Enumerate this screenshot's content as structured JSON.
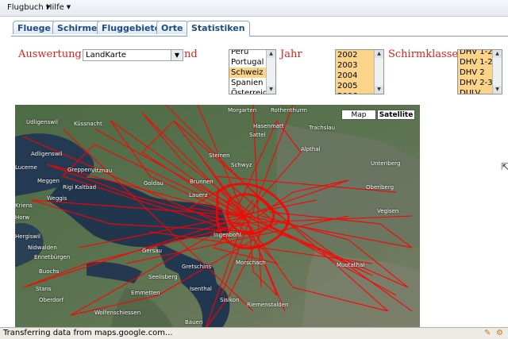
{
  "menubar": {
    "items": [
      {
        "label": "Flugbuch"
      },
      {
        "label": "Hilfe"
      }
    ]
  },
  "tabs": [
    {
      "label": "Fluege"
    },
    {
      "label": "Schirme"
    },
    {
      "label": "Fluggebiete"
    },
    {
      "label": "Orte"
    },
    {
      "label": "Statistiken",
      "active": true
    }
  ],
  "filters": {
    "auswertung_label": "Auswertung",
    "auswertung_value": "LandKarte",
    "land_label_fragment": "nd",
    "land_options": [
      "Peru",
      "Portugal",
      "Schweiz",
      "Spanien",
      "Österreich"
    ],
    "land_selected": "Schweiz",
    "jahr_label": "Jahr",
    "jahr_options": [
      "2002",
      "2003",
      "2004",
      "2005",
      "2006"
    ],
    "schirmklasse_label": "Schirmklasse",
    "schirmklasse_options": [
      "DHV 1-2",
      "DHV 1-2",
      "DHV 2",
      "DHV 2-3",
      "DULV"
    ]
  },
  "map": {
    "map_button": "Map",
    "satellite_button": "Satellite",
    "active_type": "Satellite",
    "places": [
      {
        "name": "Rothenthurm"
      },
      {
        "name": "Morgarten"
      },
      {
        "name": "Udligenswil"
      },
      {
        "name": "Küssnacht"
      },
      {
        "name": "Vitznau"
      },
      {
        "name": "Lucerne"
      },
      {
        "name": "Weggis"
      },
      {
        "name": "Brunnen"
      },
      {
        "name": "Schwyz"
      },
      {
        "name": "Sattel"
      },
      {
        "name": "Steinen"
      },
      {
        "name": "Gersau"
      },
      {
        "name": "Alpthal"
      },
      {
        "name": "Unteriberg"
      },
      {
        "name": "Oberiberg"
      },
      {
        "name": "Lauerz"
      },
      {
        "name": "Ingenbohl"
      },
      {
        "name": "Morschach"
      },
      {
        "name": "Sisikon"
      },
      {
        "name": "Riemenstalden"
      },
      {
        "name": "Seelisberg"
      },
      {
        "name": "Emmetten"
      },
      {
        "name": "Buochs"
      },
      {
        "name": "Stans"
      },
      {
        "name": "Ennetbürgen"
      },
      {
        "name": "Nidwalden"
      },
      {
        "name": "Wolfenschiessen"
      },
      {
        "name": "Bauen"
      },
      {
        "name": "Muotathal"
      },
      {
        "name": "Vegisen"
      },
      {
        "name": "Goldau"
      },
      {
        "name": "Rigi Kaltbad"
      },
      {
        "name": "Hergiswil"
      },
      {
        "name": "Oberdorf"
      },
      {
        "name": "Isenthal"
      },
      {
        "name": "Gretschins"
      },
      {
        "name": "Hasenmatt"
      },
      {
        "name": "Trachslau"
      },
      {
        "name": "Greppen"
      },
      {
        "name": "Meggen"
      },
      {
        "name": "Adligenswil"
      },
      {
        "name": "Horw"
      },
      {
        "name": "Kriens"
      }
    ]
  },
  "statusbar": {
    "text": "Transferring data from maps.google.com..."
  },
  "colors": {
    "label_red": "#e0201b",
    "track_red": "#ff0000",
    "selected_option": "#fbd48a",
    "tab_text": "#1b4d87"
  }
}
